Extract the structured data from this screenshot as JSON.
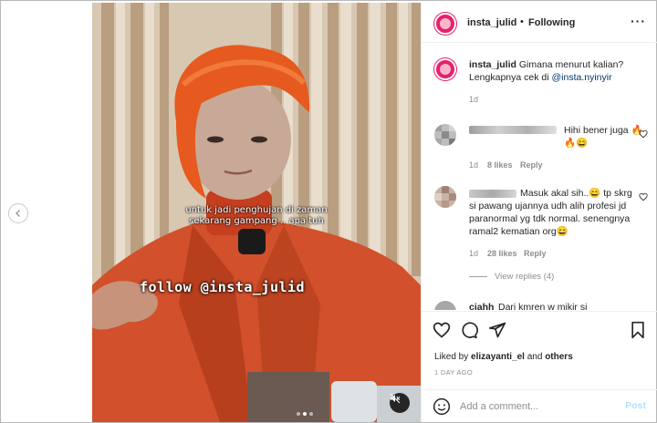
{
  "post": {
    "username": "insta_julid",
    "separator": "•",
    "follow_status": "Following",
    "more_glyph": "···"
  },
  "media": {
    "overlay_caption_line1": "untuk jadi penghujan di zaman",
    "overlay_caption_line2": "sekarang gampang .. apa tuh",
    "overlay_follow": "follow @insta_julid",
    "carousel_dots": 3,
    "carousel_active": 1
  },
  "caption": {
    "username": "insta_julid",
    "text": "Gimana menurut kalian? Lengkapnya cek di",
    "mention": "@insta.nyinyir",
    "age": "1d"
  },
  "comments": [
    {
      "username_hidden": "bertud_____mauhanz",
      "text": "Hihi bener juga 🔥🔥😄",
      "age": "1d",
      "likes": "8 likes",
      "reply_label": "Reply"
    },
    {
      "username_hidden": "______",
      "text": "Masuk akal sih..😄 tp skrg si pawang ujannya udh alih profesi jd paranormal yg tdk normal. senengnya ramal2 kematian org😄",
      "age": "1d",
      "likes": "28 likes",
      "reply_label": "Reply",
      "view_replies": "View replies (4)"
    },
    {
      "username": "ciahh",
      "text": "Dari kmren w mikir si"
    }
  ],
  "actions": {
    "liked_prefix": "Liked by",
    "liked_user": "elizayanti_el",
    "liked_and": "and",
    "liked_others": "others",
    "time_ago": "1 DAY AGO"
  },
  "comment_box": {
    "placeholder": "Add a comment...",
    "post_label": "Post"
  }
}
